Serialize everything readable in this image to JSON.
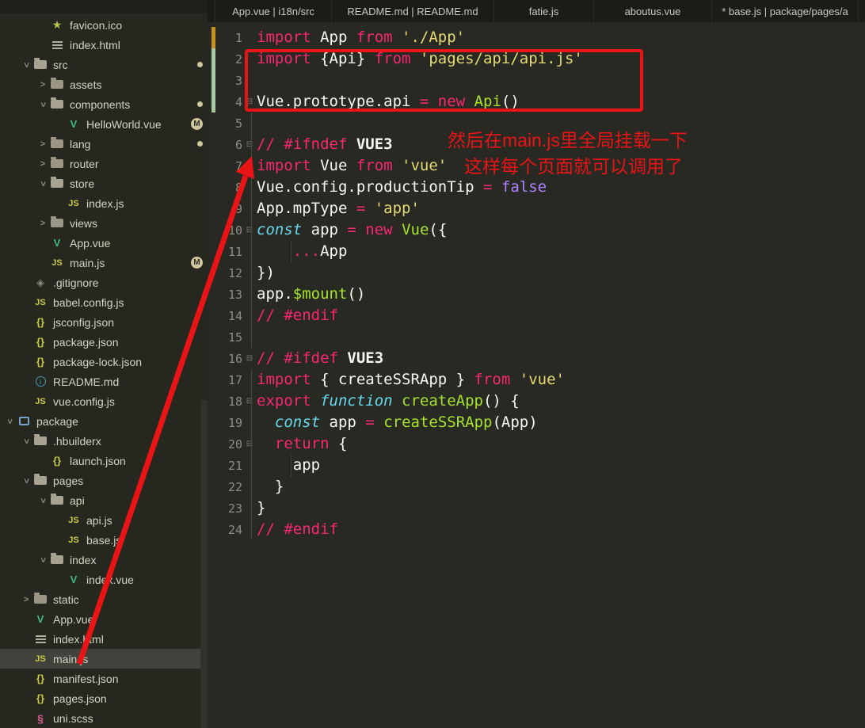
{
  "tabs": [
    {
      "label": "App.vue | i18n/src"
    },
    {
      "label": "README.md | README.md"
    },
    {
      "label": "fatie.js"
    },
    {
      "label": "aboutus.vue"
    },
    {
      "label": "* base.js | package/pages/a"
    }
  ],
  "sidebar": {
    "items": [
      {
        "label": "favicon.ico",
        "icon": "star",
        "level": 2
      },
      {
        "label": "index.html",
        "icon": "html",
        "level": 2
      },
      {
        "label": "src",
        "icon": "folder-open",
        "level": 1,
        "chevron": "down",
        "badge": "dot"
      },
      {
        "label": "assets",
        "icon": "folder",
        "level": 2,
        "chevron": "right"
      },
      {
        "label": "components",
        "icon": "folder-open",
        "level": 2,
        "chevron": "down",
        "badge": "dot"
      },
      {
        "label": "HelloWorld.vue",
        "icon": "vue",
        "level": 3,
        "badge": "M"
      },
      {
        "label": "lang",
        "icon": "folder",
        "level": 2,
        "chevron": "right",
        "badge": "dot"
      },
      {
        "label": "router",
        "icon": "folder",
        "level": 2,
        "chevron": "right"
      },
      {
        "label": "store",
        "icon": "folder-open",
        "level": 2,
        "chevron": "down"
      },
      {
        "label": "index.js",
        "icon": "js",
        "level": 3
      },
      {
        "label": "views",
        "icon": "folder",
        "level": 2,
        "chevron": "right"
      },
      {
        "label": "App.vue",
        "icon": "vue",
        "level": 2
      },
      {
        "label": "main.js",
        "icon": "js",
        "level": 2,
        "badge": "M"
      },
      {
        "label": ".gitignore",
        "icon": "git",
        "level": 1
      },
      {
        "label": "babel.config.js",
        "icon": "js",
        "level": 1
      },
      {
        "label": "jsconfig.json",
        "icon": "braces",
        "level": 1
      },
      {
        "label": "package.json",
        "icon": "braces",
        "level": 1
      },
      {
        "label": "package-lock.json",
        "icon": "braces",
        "level": 1
      },
      {
        "label": "README.md",
        "icon": "info",
        "level": 1
      },
      {
        "label": "vue.config.js",
        "icon": "js",
        "level": 1
      },
      {
        "label": "package",
        "icon": "project",
        "level": 0,
        "chevron": "down"
      },
      {
        "label": ".hbuilderx",
        "icon": "folder-open",
        "level": 1,
        "chevron": "down"
      },
      {
        "label": "launch.json",
        "icon": "braces",
        "level": 2
      },
      {
        "label": "pages",
        "icon": "folder-open",
        "level": 1,
        "chevron": "down"
      },
      {
        "label": "api",
        "icon": "folder-open",
        "level": 2,
        "chevron": "down"
      },
      {
        "label": "api.js",
        "icon": "js",
        "level": 3
      },
      {
        "label": "base.js",
        "icon": "js",
        "level": 3
      },
      {
        "label": "index",
        "icon": "folder-open",
        "level": 2,
        "chevron": "down"
      },
      {
        "label": "index.vue",
        "icon": "vue",
        "level": 3
      },
      {
        "label": "static",
        "icon": "folder",
        "level": 1,
        "chevron": "right"
      },
      {
        "label": "App.vue",
        "icon": "vue",
        "level": 1
      },
      {
        "label": "index.html",
        "icon": "html",
        "level": 1
      },
      {
        "label": "main.js",
        "icon": "js",
        "level": 1,
        "selected": true
      },
      {
        "label": "manifest.json",
        "icon": "braces",
        "level": 1
      },
      {
        "label": "pages.json",
        "icon": "braces",
        "level": 1
      },
      {
        "label": "uni.scss",
        "icon": "scss",
        "level": 1
      }
    ]
  },
  "editor": {
    "lines": [
      {
        "n": 1,
        "marker": "orange",
        "tokens": [
          [
            "k",
            "import "
          ],
          [
            "w",
            "App "
          ],
          [
            "k",
            "from "
          ],
          [
            "s",
            "'./App'"
          ]
        ]
      },
      {
        "n": 2,
        "marker": "green",
        "tokens": [
          [
            "k",
            "import "
          ],
          [
            "w",
            "{Api} "
          ],
          [
            "k",
            "from "
          ],
          [
            "s",
            "'pages/api/api.js'"
          ]
        ]
      },
      {
        "n": 3,
        "marker": "green",
        "tokens": []
      },
      {
        "n": 4,
        "marker": "green",
        "fold": true,
        "tokens": [
          [
            "w",
            "Vue.prototype.api "
          ],
          [
            "k",
            "= "
          ],
          [
            "k",
            "new "
          ],
          [
            "f",
            "Api"
          ],
          [
            "w",
            "()"
          ]
        ]
      },
      {
        "n": 5,
        "tokens": []
      },
      {
        "n": 6,
        "fold": true,
        "tokens": [
          [
            "k",
            "// #ifndef "
          ],
          [
            "b",
            "VUE3"
          ]
        ]
      },
      {
        "n": 7,
        "tokens": [
          [
            "k",
            "import "
          ],
          [
            "w",
            "Vue "
          ],
          [
            "k",
            "from "
          ],
          [
            "s",
            "'vue'"
          ]
        ]
      },
      {
        "n": 8,
        "tokens": [
          [
            "w",
            "Vue.config.productionTip "
          ],
          [
            "k",
            "= "
          ],
          [
            "p",
            "false"
          ]
        ]
      },
      {
        "n": 9,
        "tokens": [
          [
            "w",
            "App.mpType "
          ],
          [
            "k",
            "= "
          ],
          [
            "s",
            "'app'"
          ]
        ]
      },
      {
        "n": 10,
        "fold": true,
        "tokens": [
          [
            "t",
            "const "
          ],
          [
            "w",
            "app "
          ],
          [
            "k",
            "= "
          ],
          [
            "k",
            "new "
          ],
          [
            "f",
            "Vue"
          ],
          [
            "w",
            "({"
          ]
        ]
      },
      {
        "n": 11,
        "indentGuide": true,
        "tokens": [
          [
            "w",
            "    "
          ],
          [
            "k",
            "..."
          ],
          [
            "w",
            "App"
          ]
        ]
      },
      {
        "n": 12,
        "tokens": [
          [
            "w",
            "})"
          ]
        ]
      },
      {
        "n": 13,
        "tokens": [
          [
            "w",
            "app."
          ],
          [
            "f",
            "$mount"
          ],
          [
            "w",
            "()"
          ]
        ]
      },
      {
        "n": 14,
        "tokens": [
          [
            "k",
            "// #endif"
          ]
        ]
      },
      {
        "n": 15,
        "tokens": []
      },
      {
        "n": 16,
        "fold": true,
        "tokens": [
          [
            "k",
            "// #ifdef "
          ],
          [
            "b",
            "VUE3"
          ]
        ]
      },
      {
        "n": 17,
        "tokens": [
          [
            "k",
            "import "
          ],
          [
            "w",
            "{ createSSRApp } "
          ],
          [
            "k",
            "from "
          ],
          [
            "s",
            "'vue'"
          ]
        ]
      },
      {
        "n": 18,
        "fold": true,
        "tokens": [
          [
            "k",
            "export "
          ],
          [
            "t",
            "function "
          ],
          [
            "f",
            "createApp"
          ],
          [
            "w",
            "() {"
          ]
        ]
      },
      {
        "n": 19,
        "tokens": [
          [
            "w",
            "  "
          ],
          [
            "t",
            "const "
          ],
          [
            "w",
            "app "
          ],
          [
            "k",
            "= "
          ],
          [
            "f",
            "createSSRApp"
          ],
          [
            "w",
            "(App)"
          ]
        ]
      },
      {
        "n": 20,
        "fold": true,
        "tokens": [
          [
            "w",
            "  "
          ],
          [
            "k",
            "return "
          ],
          [
            "w",
            "{"
          ]
        ]
      },
      {
        "n": 21,
        "indentGuide": true,
        "tokens": [
          [
            "w",
            "    app"
          ]
        ]
      },
      {
        "n": 22,
        "tokens": [
          [
            "w",
            "  }"
          ]
        ]
      },
      {
        "n": 23,
        "tokens": [
          [
            "w",
            "}"
          ]
        ]
      },
      {
        "n": 24,
        "tokens": [
          [
            "k",
            "// #endif"
          ]
        ]
      }
    ]
  },
  "annotations": {
    "note1": "然后在main.js里全局挂载一下",
    "note2": "这样每个页面就可以调用了",
    "color": "#e81416"
  },
  "theme": {
    "editor_bg": "#282922",
    "sidebar_bg": "#26271f",
    "tabbar_bg": "#1b1c16",
    "keyword": "#f92672",
    "string": "#e6db74",
    "type": "#66d9ef",
    "function": "#a6e22e",
    "constant": "#ae81ff",
    "text": "#f8f8f2",
    "modified_badge": "#cfc79d",
    "gutter_added": "#a9c9a0",
    "gutter_changed": "#c79121"
  }
}
